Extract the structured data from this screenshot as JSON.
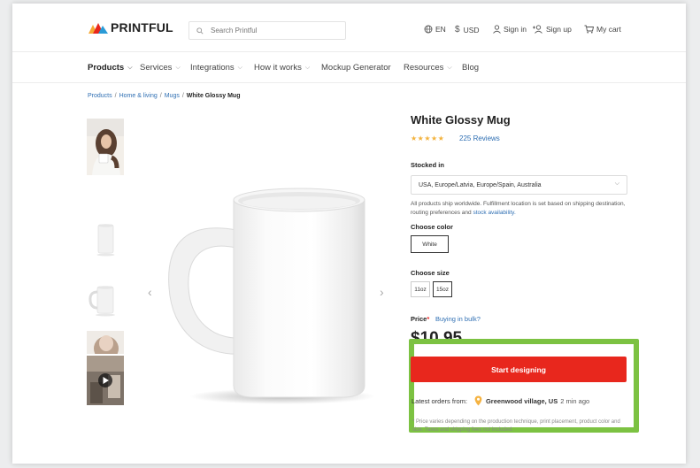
{
  "header": {
    "brand": "PRINTFUL",
    "search_placeholder": "Search Printful",
    "language": "EN",
    "currency": "USD",
    "sign_in": "Sign in",
    "sign_up": "Sign up",
    "cart": "My cart"
  },
  "nav": {
    "items": [
      {
        "label": "Products",
        "has_dropdown": true,
        "active": true
      },
      {
        "label": "Services",
        "has_dropdown": true
      },
      {
        "label": "Integrations",
        "has_dropdown": true
      },
      {
        "label": "How it works",
        "has_dropdown": true
      },
      {
        "label": "Mockup Generator",
        "has_dropdown": false
      },
      {
        "label": "Resources",
        "has_dropdown": true
      },
      {
        "label": "Blog",
        "has_dropdown": false
      }
    ]
  },
  "breadcrumb": {
    "items": [
      "Products",
      "Home & living",
      "Mugs"
    ],
    "current": "White Glossy Mug",
    "separator": "/"
  },
  "product": {
    "title": "White Glossy Mug",
    "rating_stars": "★★★★★",
    "rating": 5,
    "reviews": "225 Reviews",
    "stocked_label": "Stocked in",
    "stocked_value": "USA, Europe/Latvia, Europe/Spain, Australia",
    "ship_note": "All products ship worldwide. Fulfillment location is set based on shipping destination, routing preferences and",
    "ship_link": "stock availability.",
    "color_label": "Choose color",
    "colors": [
      "White"
    ],
    "size_label": "Choose size",
    "sizes": [
      "11oz",
      "15oz"
    ],
    "selected_size": "15oz",
    "price_label": "Price",
    "price_asterisk": "*",
    "bulk_link": "Buying in bulk?",
    "price": "$10.95",
    "cta": "Start designing",
    "orders_prefix": "Latest orders from:",
    "orders_location": "Greenwood village, US",
    "orders_time": "2 min ago",
    "fineprint": "* Price varies depending on the production technique, print placement, product color and size. Taxes and shipping fees not included."
  },
  "colors": {
    "brand_red": "#e8271d",
    "link_blue": "#2f6fb3",
    "highlight_green": "#7cc242",
    "star": "#f3b23c"
  }
}
